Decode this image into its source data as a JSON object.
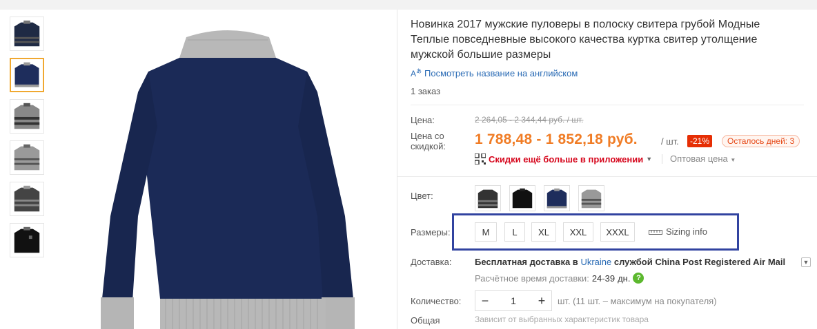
{
  "product": {
    "title": "Новинка 2017 мужские пуловеры в полоску свитера грубой Модные Теплые повседневные высокого качества куртка свитер утолщение мужской большие размеры",
    "translate_link": "Посмотреть название на английском",
    "translate_icon": "translate-icon",
    "orders": "1 заказ"
  },
  "thumbnails": [
    {
      "colors": [
        "#1f2a44",
        "#555"
      ]
    },
    {
      "colors": [
        "#1e2d5c",
        "#999"
      ]
    },
    {
      "colors": [
        "#888",
        "#333"
      ]
    },
    {
      "colors": [
        "#9a9a9a",
        "#555"
      ]
    },
    {
      "colors": [
        "#444",
        "#888"
      ]
    },
    {
      "colors": [
        "#111",
        "#666"
      ]
    }
  ],
  "price": {
    "label": "Цена:",
    "old": "2 264,05 - 2 344,44 руб. / шт.",
    "discount_label_1": "Цена со",
    "discount_label_2": "скидкой:",
    "current": "1 788,48 - 1 852,18 руб.",
    "unit": "/ шт.",
    "discount_badge": "-21%",
    "days_left": "Осталось дней: 3",
    "app_discount": "Скидки ещё больше в приложении",
    "wholesale": "Оптовая цена"
  },
  "color": {
    "label": "Цвет:",
    "swatches": [
      {
        "colors": [
          "#333",
          "#777"
        ]
      },
      {
        "colors": [
          "#111",
          "#222"
        ]
      },
      {
        "colors": [
          "#1e2d5c",
          "#999"
        ]
      },
      {
        "colors": [
          "#999",
          "#555"
        ]
      }
    ]
  },
  "sizes": {
    "label": "Размеры:",
    "options": [
      "M",
      "L",
      "XL",
      "XXL",
      "XXXL"
    ],
    "sizing_info": "Sizing info"
  },
  "shipping": {
    "label": "Доставка:",
    "prefix": "Бесплатная доставка в",
    "country": "Ukraine",
    "suffix": "службой China Post Registered Air Mail",
    "estimate_label": "Расчётное время доставки:",
    "estimate_value": "24-39",
    "estimate_unit": "дн."
  },
  "quantity": {
    "label": "Количество:",
    "value": "1",
    "note": "шт. (11 шт. – максимум на покупателя)"
  },
  "total": {
    "label": "Общая",
    "note": "Зависит от выбранных характеристик товара"
  },
  "colors": {
    "accent": "#f07c25",
    "highlight_box": "#3143a0",
    "thumb_active": "#f0a830",
    "discount_badge": "#e62e04"
  }
}
